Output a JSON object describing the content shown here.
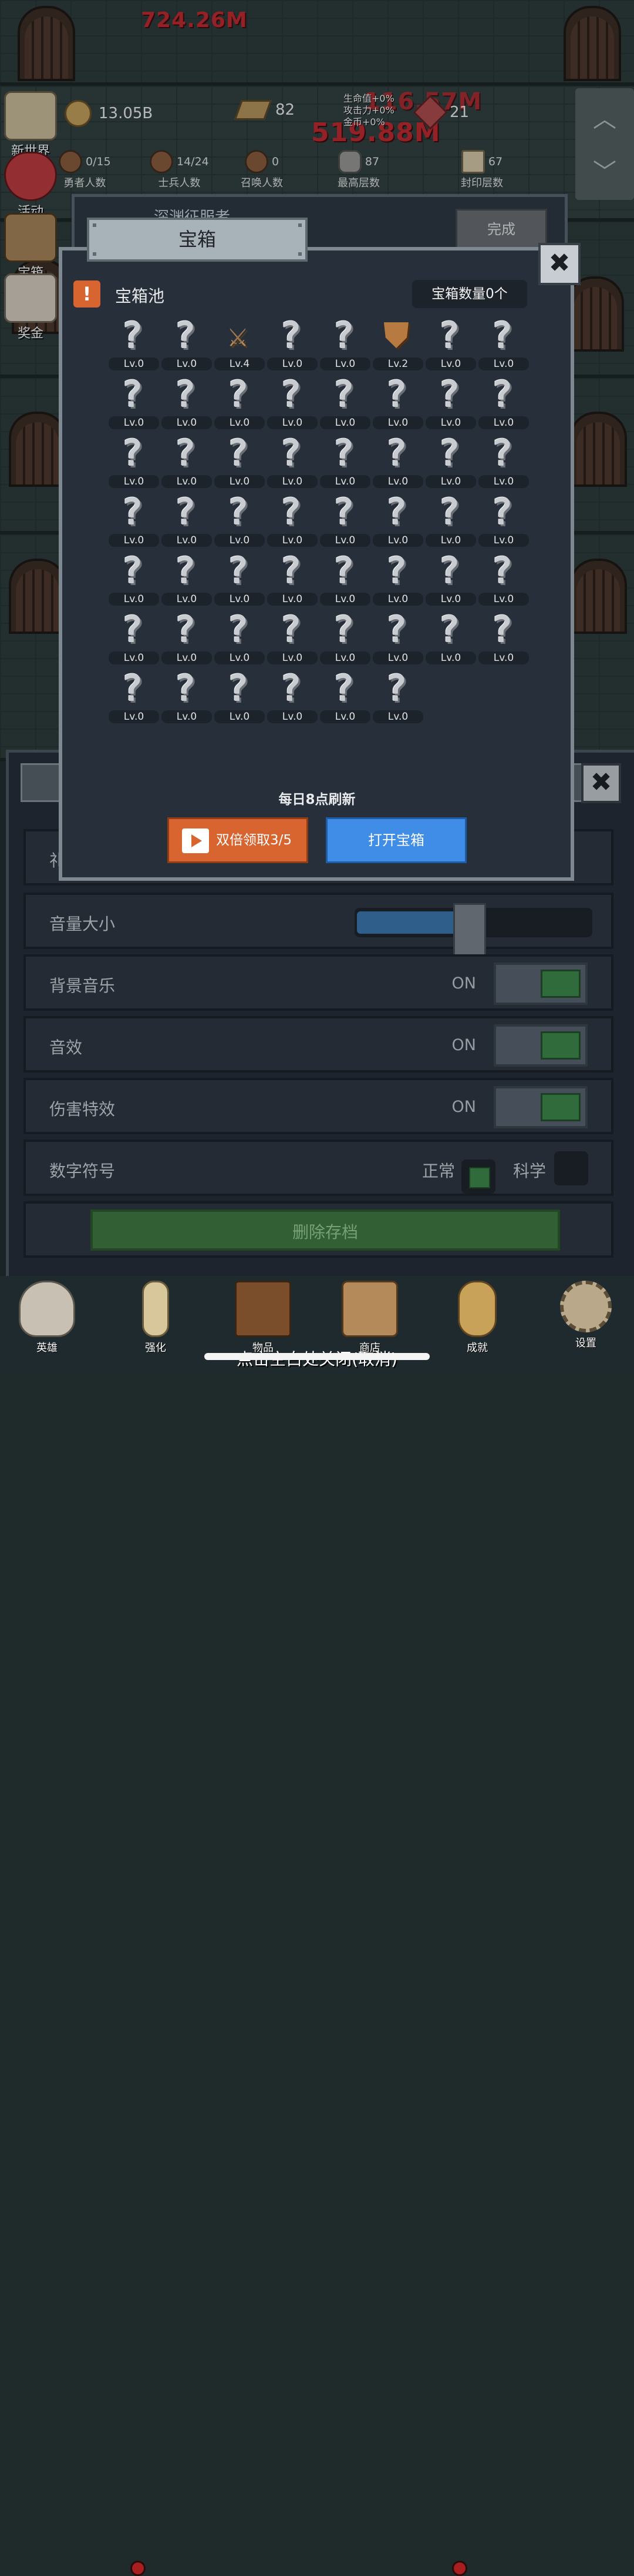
{
  "background": {
    "damage_numbers": [
      "724.26M",
      "519.88M",
      "116.57M"
    ]
  },
  "hud": {
    "gold": "13.05B",
    "ingot": "82",
    "gem": "21",
    "buffs": [
      "生命值+0%",
      "攻击力+0%",
      "金币+0%"
    ],
    "stats": [
      {
        "value": "0/15",
        "label": "勇者人数"
      },
      {
        "value": "14/24",
        "label": "士兵人数"
      },
      {
        "value": "0",
        "label": "召唤人数"
      },
      {
        "value": "87",
        "label": "最高层数"
      },
      {
        "value": "67",
        "label": "封印层数"
      }
    ]
  },
  "side_menu": [
    "新世界",
    "活动",
    "宝箱",
    "奖金"
  ],
  "quest": {
    "title": "深渊征服者",
    "done_label": "完成"
  },
  "dialog": {
    "title": "宝箱",
    "pool_icon": "!",
    "pool_label": "宝箱池",
    "chest_count": "宝箱数量0个",
    "slots": [
      {
        "icon": "?",
        "lv": "Lv.0"
      },
      {
        "icon": "?",
        "lv": "Lv.0"
      },
      {
        "icon": "sword",
        "lv": "Lv.4"
      },
      {
        "icon": "?",
        "lv": "Lv.0"
      },
      {
        "icon": "?",
        "lv": "Lv.0"
      },
      {
        "icon": "armor",
        "lv": "Lv.2"
      },
      {
        "icon": "?",
        "lv": "Lv.0"
      },
      {
        "icon": "?",
        "lv": "Lv.0"
      },
      {
        "icon": "?",
        "lv": "Lv.0"
      },
      {
        "icon": "?",
        "lv": "Lv.0"
      },
      {
        "icon": "?",
        "lv": "Lv.0"
      },
      {
        "icon": "?",
        "lv": "Lv.0"
      },
      {
        "icon": "?",
        "lv": "Lv.0"
      },
      {
        "icon": "?",
        "lv": "Lv.0"
      },
      {
        "icon": "?",
        "lv": "Lv.0"
      },
      {
        "icon": "?",
        "lv": "Lv.0"
      },
      {
        "icon": "?",
        "lv": "Lv.0"
      },
      {
        "icon": "?",
        "lv": "Lv.0"
      },
      {
        "icon": "?",
        "lv": "Lv.0"
      },
      {
        "icon": "?",
        "lv": "Lv.0"
      },
      {
        "icon": "?",
        "lv": "Lv.0"
      },
      {
        "icon": "?",
        "lv": "Lv.0"
      },
      {
        "icon": "?",
        "lv": "Lv.0"
      },
      {
        "icon": "?",
        "lv": "Lv.0"
      },
      {
        "icon": "?",
        "lv": "Lv.0"
      },
      {
        "icon": "?",
        "lv": "Lv.0"
      },
      {
        "icon": "?",
        "lv": "Lv.0"
      },
      {
        "icon": "?",
        "lv": "Lv.0"
      },
      {
        "icon": "?",
        "lv": "Lv.0"
      },
      {
        "icon": "?",
        "lv": "Lv.0"
      },
      {
        "icon": "?",
        "lv": "Lv.0"
      },
      {
        "icon": "?",
        "lv": "Lv.0"
      },
      {
        "icon": "?",
        "lv": "Lv.0"
      },
      {
        "icon": "?",
        "lv": "Lv.0"
      },
      {
        "icon": "?",
        "lv": "Lv.0"
      },
      {
        "icon": "?",
        "lv": "Lv.0"
      },
      {
        "icon": "?",
        "lv": "Lv.0"
      },
      {
        "icon": "?",
        "lv": "Lv.0"
      },
      {
        "icon": "?",
        "lv": "Lv.0"
      },
      {
        "icon": "?",
        "lv": "Lv.0"
      },
      {
        "icon": "?",
        "lv": "Lv.0"
      },
      {
        "icon": "?",
        "lv": "Lv.0"
      },
      {
        "icon": "?",
        "lv": "Lv.0"
      },
      {
        "icon": "?",
        "lv": "Lv.0"
      },
      {
        "icon": "?",
        "lv": "Lv.0"
      },
      {
        "icon": "?",
        "lv": "Lv.0"
      },
      {
        "icon": "?",
        "lv": "Lv.0"
      },
      {
        "icon": "?",
        "lv": "Lv.0"
      },
      {
        "icon": "?",
        "lv": "Lv.0"
      },
      {
        "icon": "?",
        "lv": "Lv.0"
      },
      {
        "icon": "?",
        "lv": "Lv.0"
      },
      {
        "icon": "?",
        "lv": "Lv.0"
      },
      {
        "icon": "?",
        "lv": "Lv.0"
      },
      {
        "icon": "?",
        "lv": "Lv.0"
      }
    ],
    "refresh_note": "每日8点刷新",
    "double_button": "双倍领取3/5",
    "open_button": "打开宝箱",
    "close_icon": "✖"
  },
  "settings": {
    "partial_row": "礼",
    "volume_label": "音量大小",
    "volume_level_percent": 48,
    "rows": [
      {
        "label": "背景音乐",
        "state": "ON"
      },
      {
        "label": "音效",
        "state": "ON"
      },
      {
        "label": "伤害特效",
        "state": "ON"
      }
    ],
    "number_format_label": "数字符号",
    "number_format_options": [
      "正常",
      "科学"
    ],
    "delete_label": "删除存档",
    "close_icon": "✖"
  },
  "bottom_nav": [
    "英雄",
    "强化",
    "物品",
    "商店",
    "成就",
    "设置"
  ],
  "hint_text": "点击空白处关闭(取消)"
}
